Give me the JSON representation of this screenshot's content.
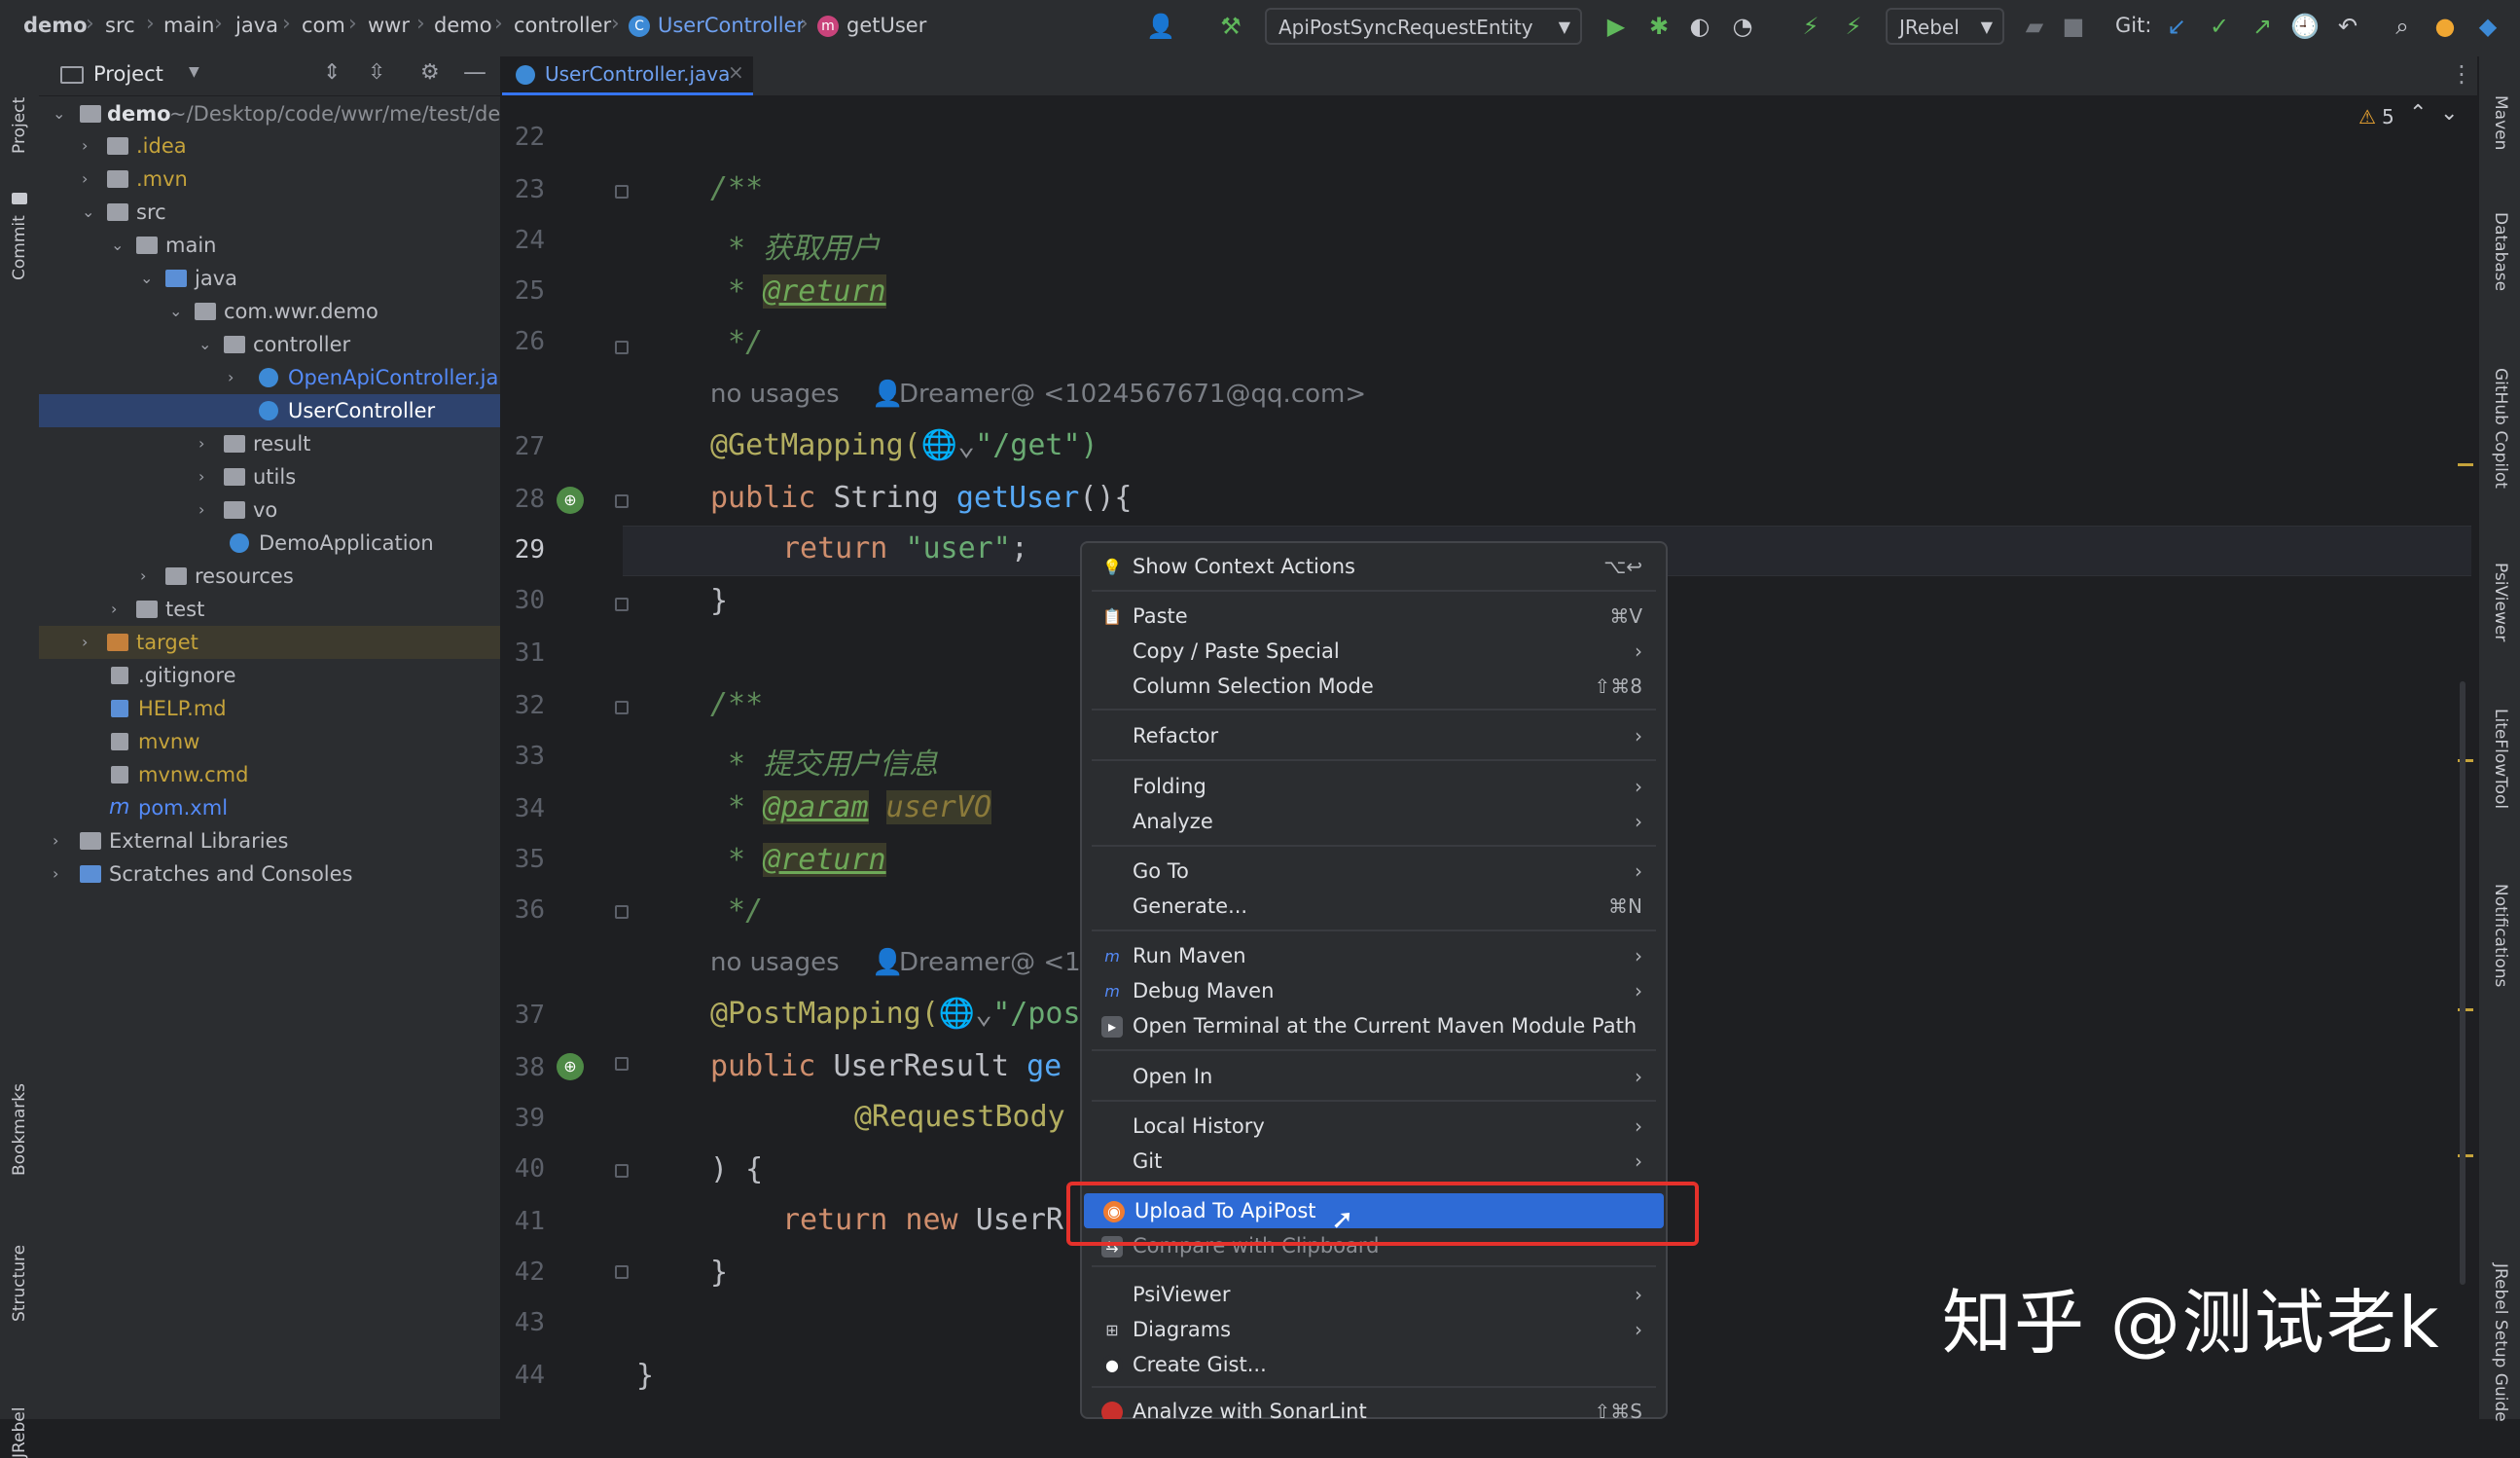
{
  "breadcrumbs": [
    "demo",
    "src",
    "main",
    "java",
    "com",
    "wwr",
    "demo",
    "controller",
    "UserController",
    "getUser"
  ],
  "toolbar": {
    "run_config": "ApiPostSyncRequestEntity",
    "jrebel": "JRebel",
    "git_label": "Git:"
  },
  "left_strip": {
    "project": "Project",
    "commit": "Commit",
    "bookmarks": "Bookmarks",
    "structure": "Structure",
    "jrebel": "JRebel"
  },
  "project_panel": {
    "title": "Project",
    "root_name": "demo",
    "root_path": "~/Desktop/code/wwr/me/test/de",
    "items": [
      {
        "label": ".idea",
        "color": "#c5a33b"
      },
      {
        "label": ".mvn",
        "color": "#c5a33b"
      },
      {
        "label": "src",
        "color": "#c8cad0"
      },
      {
        "label": "main",
        "color": "#c8cad0"
      },
      {
        "label": "java",
        "color": "#c8cad0"
      },
      {
        "label": "com.wwr.demo",
        "color": "#c8cad0"
      },
      {
        "label": "controller",
        "color": "#c8cad0"
      },
      {
        "label": "OpenApiController.ja",
        "color": "#548af7"
      },
      {
        "label": "UserController",
        "color": "#ffffff"
      },
      {
        "label": "result",
        "color": "#c8cad0"
      },
      {
        "label": "utils",
        "color": "#c8cad0"
      },
      {
        "label": "vo",
        "color": "#c8cad0"
      },
      {
        "label": "DemoApplication",
        "color": "#c8cad0"
      },
      {
        "label": "resources",
        "color": "#c8cad0"
      },
      {
        "label": "test",
        "color": "#c8cad0"
      },
      {
        "label": "target",
        "color": "#c5a33b"
      },
      {
        "label": ".gitignore",
        "color": "#c8cad0"
      },
      {
        "label": "HELP.md",
        "color": "#c5a33b"
      },
      {
        "label": "mvnw",
        "color": "#c5a33b"
      },
      {
        "label": "mvnw.cmd",
        "color": "#c5a33b"
      },
      {
        "label": "pom.xml",
        "color": "#548af7"
      },
      {
        "label": "External Libraries",
        "color": "#c8cad0"
      },
      {
        "label": "Scratches and Consoles",
        "color": "#c8cad0"
      }
    ]
  },
  "editor": {
    "tab": "UserController.java",
    "warning_count": "5",
    "line_numbers": [
      "22",
      "23",
      "24",
      "25",
      "26",
      "27",
      "28",
      "29",
      "30",
      "31",
      "32",
      "33",
      "34",
      "35",
      "36",
      "37",
      "38",
      "39",
      "40",
      "41",
      "42",
      "43",
      "44"
    ],
    "code": {
      "l23": "/**",
      "l24": " * 获取用户",
      "l25_star": " * ",
      "l25_tag": "@return",
      "l26": " */",
      "hint1_usage": "no usages",
      "hint1_author": "Dreamer@ <1024567671@qq.com>",
      "l27_anno": "@GetMapping(",
      "l27_str": "\"/get\")",
      "l28_kw": "public ",
      "l28_type": "String ",
      "l28_fn": "getUser",
      "l28_rest": "(){",
      "l29_kw": "return ",
      "l29_str": "\"user\"",
      "l29_end": ";",
      "l30": "}",
      "l32": "/**",
      "l33": " * 提交用户信息",
      "l34_star": " * ",
      "l34_tag": "@param",
      "l34_param": "userVO",
      "l35_star": " * ",
      "l35_tag": "@return",
      "l36": " */",
      "hint2_usage": "no usages",
      "hint2_author": "Dreamer@ <10",
      "l37_anno": "@PostMapping(",
      "l37_str": "\"/pos",
      "l38_kw": "public ",
      "l38_type": "UserResult ",
      "l38_fn": "ge",
      "l39_anno": "@RequestBody",
      "l40": ") {",
      "l41_kw": "return new ",
      "l41_type": "UserR",
      "l42": "}",
      "l44": "}"
    }
  },
  "context_menu": [
    {
      "label": "Show Context Actions",
      "shortcut": "⌥↩",
      "icon": "bulb-icon"
    },
    {
      "label": "Paste",
      "shortcut": "⌘V",
      "icon": "paste-icon"
    },
    {
      "label": "Copy / Paste Special",
      "shortcut": "›"
    },
    {
      "label": "Column Selection Mode",
      "shortcut": "⇧⌘8"
    },
    {
      "label": "Refactor",
      "shortcut": "›"
    },
    {
      "label": "Folding",
      "shortcut": "›"
    },
    {
      "label": "Analyze",
      "shortcut": "›"
    },
    {
      "label": "Go To",
      "shortcut": "›"
    },
    {
      "label": "Generate...",
      "shortcut": "⌘N"
    },
    {
      "label": "Run Maven",
      "shortcut": "›",
      "icon": "maven-icon"
    },
    {
      "label": "Debug Maven",
      "shortcut": "›",
      "icon": "maven-icon"
    },
    {
      "label": "Open Terminal at the Current Maven Module Path",
      "shortcut": "",
      "icon": "terminal-icon"
    },
    {
      "label": "Open In",
      "shortcut": "›"
    },
    {
      "label": "Local History",
      "shortcut": "›"
    },
    {
      "label": "Git",
      "shortcut": "›"
    },
    {
      "label": "Upload To ApiPost",
      "shortcut": "",
      "icon": "apipost-icon"
    },
    {
      "label": "Compare with Clipboard",
      "shortcut": "",
      "icon": "compare-icon"
    },
    {
      "label": "PsiViewer",
      "shortcut": "›"
    },
    {
      "label": "Diagrams",
      "shortcut": "›",
      "icon": "diagram-icon"
    },
    {
      "label": "Create Gist...",
      "shortcut": "",
      "icon": "github-icon"
    },
    {
      "label": "Analyze with SonarLint",
      "shortcut": "⇧⌘S",
      "icon": "sonarlint-icon"
    }
  ],
  "right_strip": [
    "Maven",
    "Database",
    "GitHub Copilot",
    "PsiViewer",
    "LiteFlowTool",
    "Notifications",
    "JRebel Setup Guide"
  ],
  "watermark": "知乎 @测试老k",
  "colors": {
    "accent": "#2e6bd6",
    "highlight_border": "#e5312b",
    "selected_row": "#2e436e"
  }
}
